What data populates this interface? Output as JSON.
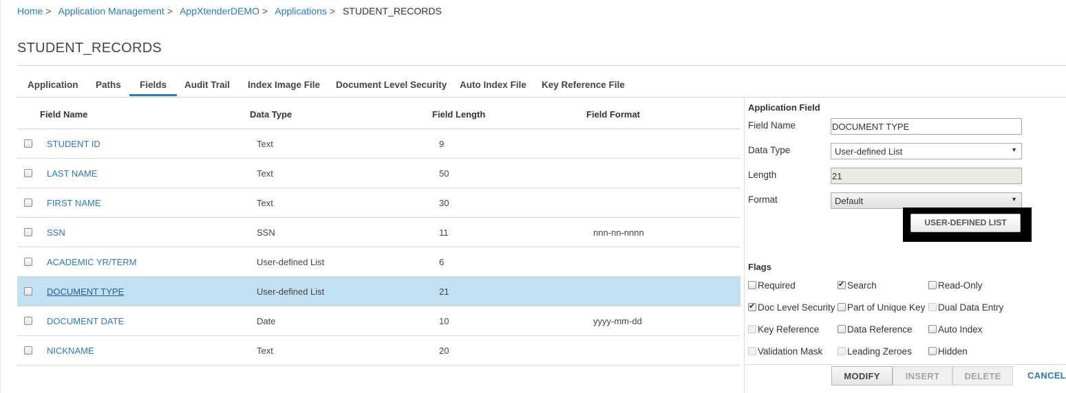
{
  "breadcrumb": {
    "items": [
      "Home",
      "Application Management",
      "AppXtenderDEMO",
      "Applications"
    ],
    "separator": ">",
    "current": "STUDENT_RECORDS"
  },
  "page": {
    "title": "STUDENT_RECORDS"
  },
  "tabs": [
    "Application",
    "Paths",
    "Fields",
    "Audit Trail",
    "Index Image File",
    "Document Level Security",
    "Auto Index File",
    "Key Reference File"
  ],
  "active_tab": "Fields",
  "grid": {
    "headers": [
      "Field Name",
      "Data Type",
      "Field Length",
      "Field Format"
    ],
    "rows": [
      {
        "name": "STUDENT ID",
        "type": "Text",
        "length": "9",
        "format": ""
      },
      {
        "name": "LAST NAME",
        "type": "Text",
        "length": "50",
        "format": ""
      },
      {
        "name": "FIRST NAME",
        "type": "Text",
        "length": "30",
        "format": ""
      },
      {
        "name": "SSN",
        "type": "SSN",
        "length": "11",
        "format": "nnn-nn-nnnn"
      },
      {
        "name": "ACADEMIC YR/TERM",
        "type": "User-defined List",
        "length": "6",
        "format": ""
      },
      {
        "name": "DOCUMENT TYPE",
        "type": "User-defined List",
        "length": "21",
        "format": ""
      },
      {
        "name": "DOCUMENT DATE",
        "type": "Date",
        "length": "10",
        "format": "yyyy-mm-dd"
      },
      {
        "name": "NICKNAME",
        "type": "Text",
        "length": "20",
        "format": ""
      }
    ],
    "selected_row": "DOCUMENT TYPE"
  },
  "panel": {
    "title": "Application Field",
    "field_name_label": "Field Name",
    "field_name_value": "DOCUMENT TYPE",
    "data_type_label": "Data Type",
    "data_type_value": "User-defined List",
    "length_label": "Length",
    "length_value": "21",
    "format_label": "Format",
    "format_value": "Default",
    "udl_button": "USER-DEFINED LIST",
    "flags_title": "Flags",
    "flags": [
      {
        "label": "Required",
        "checked": false,
        "enabled": true
      },
      {
        "label": "Search",
        "checked": true,
        "enabled": true
      },
      {
        "label": "Read-Only",
        "checked": false,
        "enabled": true
      },
      {
        "label": "Doc Level Security",
        "checked": true,
        "enabled": true
      },
      {
        "label": "Part of Unique Key",
        "checked": false,
        "enabled": true
      },
      {
        "label": "Dual Data Entry",
        "checked": false,
        "enabled": false
      },
      {
        "label": "Key Reference",
        "checked": false,
        "enabled": false
      },
      {
        "label": "Data Reference",
        "checked": false,
        "enabled": true
      },
      {
        "label": "Auto Index",
        "checked": false,
        "enabled": true
      },
      {
        "label": "Validation Mask",
        "checked": false,
        "enabled": false
      },
      {
        "label": "Leading Zeroes",
        "checked": false,
        "enabled": false
      },
      {
        "label": "Hidden",
        "checked": false,
        "enabled": true
      }
    ]
  },
  "actions": {
    "modify": "MODIFY",
    "insert": "INSERT",
    "delete": "DELETE",
    "cancel": "CANCEL"
  },
  "colors": {
    "link": "#2a7ab8",
    "selected_row": "#c3dff2",
    "highlight_frame": "#000000"
  },
  "icons": {
    "dropdown": "caret-down-icon"
  }
}
